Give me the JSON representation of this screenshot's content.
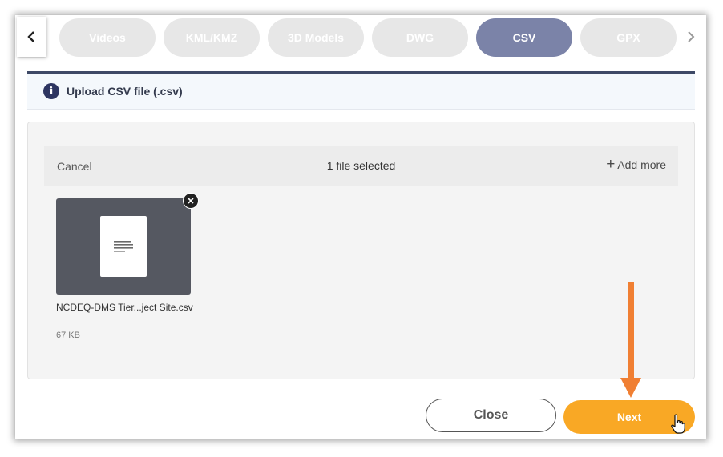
{
  "tabs": [
    {
      "label": "Videos",
      "active": false
    },
    {
      "label": "KML/KMZ",
      "active": false
    },
    {
      "label": "3D Models",
      "active": false
    },
    {
      "label": "DWG",
      "active": false
    },
    {
      "label": "CSV",
      "active": true
    },
    {
      "label": "GPX",
      "active": false
    }
  ],
  "icons": {
    "prev": "chevron-left-icon",
    "next": "chevron-right-icon",
    "info": "info-icon",
    "add": "plus-icon",
    "file": "document-icon",
    "remove": "close-icon",
    "annotation": "arrow-down-icon",
    "pointer": "hand-pointer-icon"
  },
  "info": {
    "icon_glyph": "i",
    "text": "Upload CSV file (.csv)"
  },
  "uploader": {
    "cancel_label": "Cancel",
    "status": "1 file selected",
    "add_more_label": "Add more",
    "files": [
      {
        "name": "NCDEQ-DMS Tier...ject Site.csv",
        "size": "67 KB"
      }
    ]
  },
  "footer": {
    "close_label": "Close",
    "next_label": "Next"
  },
  "colors": {
    "active_tab": "#7b83a8",
    "inactive_tab": "#e7e7e7",
    "next_button": "#f9a825",
    "annotation_arrow": "#f07f33",
    "info_accent": "#2d3561"
  }
}
